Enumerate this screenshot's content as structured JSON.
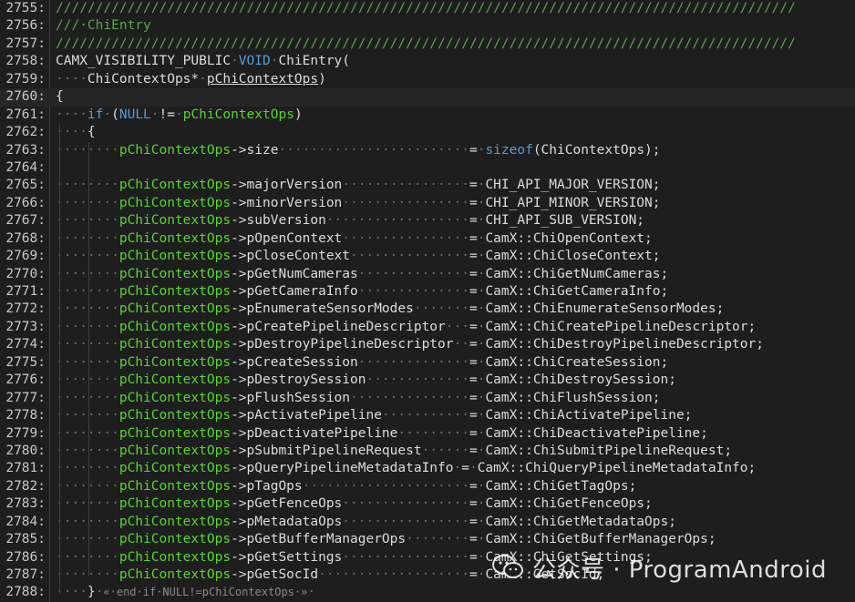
{
  "editor": {
    "lines": [
      {
        "num": "2755:",
        "tokens": [
          {
            "c": "t-comment",
            "t": "/////////////////////////////////////////////////////////////////////////////////////////////"
          }
        ]
      },
      {
        "num": "2756:",
        "tokens": [
          {
            "c": "t-comment",
            "t": "///·ChiEntry"
          }
        ]
      },
      {
        "num": "2757:",
        "tokens": [
          {
            "c": "t-comment",
            "t": "/////////////////////////////////////////////////////////////////////////////////////////////"
          }
        ]
      },
      {
        "num": "2758:",
        "tokens": [
          {
            "c": "t-plain",
            "t": "CAMX_VISIBILITY_PUBLIC"
          },
          {
            "c": "ws",
            "t": "·"
          },
          {
            "c": "t-kw",
            "t": "VOID"
          },
          {
            "c": "ws",
            "t": "·"
          },
          {
            "c": "t-plain",
            "t": "ChiEntry("
          }
        ]
      },
      {
        "num": "2759:",
        "tokens": [
          {
            "c": "ws",
            "t": "····"
          },
          {
            "c": "t-plain",
            "t": "ChiContextOps*"
          },
          {
            "c": "ws",
            "t": "·"
          },
          {
            "c": "t-param",
            "t": "pChiContextOps"
          },
          {
            "c": "t-plain",
            "t": ")"
          }
        ]
      },
      {
        "num": "2760:",
        "tokens": [
          {
            "c": "t-plain",
            "t": "{"
          }
        ]
      },
      {
        "num": "2761:",
        "tokens": [
          {
            "c": "ws",
            "t": "····"
          },
          {
            "c": "t-kw",
            "t": "if"
          },
          {
            "c": "ws",
            "t": "·"
          },
          {
            "c": "t-plain",
            "t": "("
          },
          {
            "c": "t-kw",
            "t": "NULL"
          },
          {
            "c": "ws",
            "t": "·"
          },
          {
            "c": "t-plain",
            "t": "!="
          },
          {
            "c": "ws",
            "t": "·"
          },
          {
            "c": "t-var",
            "t": "pChiContextOps"
          },
          {
            "c": "t-plain",
            "t": ")"
          }
        ]
      },
      {
        "num": "2762:",
        "tokens": [
          {
            "c": "ws",
            "t": "····"
          },
          {
            "c": "t-plain",
            "t": "{"
          }
        ]
      },
      {
        "num": "2763:",
        "tokens": [
          {
            "c": "ws",
            "t": "········"
          },
          {
            "c": "t-var",
            "t": "pChiContextOps"
          },
          {
            "c": "t-plain",
            "t": "->size"
          },
          {
            "c": "ws",
            "t": "························"
          },
          {
            "c": "t-plain",
            "t": "="
          },
          {
            "c": "ws",
            "t": "·"
          },
          {
            "c": "t-sizeof",
            "t": "sizeof"
          },
          {
            "c": "t-plain",
            "t": "(ChiContextOps);"
          }
        ]
      },
      {
        "num": "2764:",
        "tokens": []
      },
      {
        "num": "2765:",
        "tokens": [
          {
            "c": "ws",
            "t": "········"
          },
          {
            "c": "t-var",
            "t": "pChiContextOps"
          },
          {
            "c": "t-plain",
            "t": "->majorVersion"
          },
          {
            "c": "ws",
            "t": "················"
          },
          {
            "c": "t-plain",
            "t": "="
          },
          {
            "c": "ws",
            "t": "·"
          },
          {
            "c": "t-plain",
            "t": "CHI_API_MAJOR_VERSION;"
          }
        ]
      },
      {
        "num": "2766:",
        "tokens": [
          {
            "c": "ws",
            "t": "········"
          },
          {
            "c": "t-var",
            "t": "pChiContextOps"
          },
          {
            "c": "t-plain",
            "t": "->minorVersion"
          },
          {
            "c": "ws",
            "t": "················"
          },
          {
            "c": "t-plain",
            "t": "="
          },
          {
            "c": "ws",
            "t": "·"
          },
          {
            "c": "t-plain",
            "t": "CHI_API_MINOR_VERSION;"
          }
        ]
      },
      {
        "num": "2767:",
        "tokens": [
          {
            "c": "ws",
            "t": "········"
          },
          {
            "c": "t-var",
            "t": "pChiContextOps"
          },
          {
            "c": "t-plain",
            "t": "->subVersion"
          },
          {
            "c": "ws",
            "t": "··················"
          },
          {
            "c": "t-plain",
            "t": "="
          },
          {
            "c": "ws",
            "t": "·"
          },
          {
            "c": "t-plain",
            "t": "CHI_API_SUB_VERSION;"
          }
        ]
      },
      {
        "num": "2768:",
        "tokens": [
          {
            "c": "ws",
            "t": "········"
          },
          {
            "c": "t-var",
            "t": "pChiContextOps"
          },
          {
            "c": "t-plain",
            "t": "->pOpenContext"
          },
          {
            "c": "ws",
            "t": "················"
          },
          {
            "c": "t-plain",
            "t": "="
          },
          {
            "c": "ws",
            "t": "·"
          },
          {
            "c": "t-plain",
            "t": "CamX::ChiOpenContext;"
          }
        ]
      },
      {
        "num": "2769:",
        "tokens": [
          {
            "c": "ws",
            "t": "········"
          },
          {
            "c": "t-var",
            "t": "pChiContextOps"
          },
          {
            "c": "t-plain",
            "t": "->pCloseContext"
          },
          {
            "c": "ws",
            "t": "···············"
          },
          {
            "c": "t-plain",
            "t": "="
          },
          {
            "c": "ws",
            "t": "·"
          },
          {
            "c": "t-plain",
            "t": "CamX::ChiCloseContext;"
          }
        ]
      },
      {
        "num": "2770:",
        "tokens": [
          {
            "c": "ws",
            "t": "········"
          },
          {
            "c": "t-var",
            "t": "pChiContextOps"
          },
          {
            "c": "t-plain",
            "t": "->pGetNumCameras"
          },
          {
            "c": "ws",
            "t": "··············"
          },
          {
            "c": "t-plain",
            "t": "="
          },
          {
            "c": "ws",
            "t": "·"
          },
          {
            "c": "t-plain",
            "t": "CamX::ChiGetNumCameras;"
          }
        ]
      },
      {
        "num": "2771:",
        "tokens": [
          {
            "c": "ws",
            "t": "········"
          },
          {
            "c": "t-var",
            "t": "pChiContextOps"
          },
          {
            "c": "t-plain",
            "t": "->pGetCameraInfo"
          },
          {
            "c": "ws",
            "t": "··············"
          },
          {
            "c": "t-plain",
            "t": "="
          },
          {
            "c": "ws",
            "t": "·"
          },
          {
            "c": "t-plain",
            "t": "CamX::ChiGetCameraInfo;"
          }
        ]
      },
      {
        "num": "2772:",
        "tokens": [
          {
            "c": "ws",
            "t": "········"
          },
          {
            "c": "t-var",
            "t": "pChiContextOps"
          },
          {
            "c": "t-plain",
            "t": "->pEnumerateSensorModes"
          },
          {
            "c": "ws",
            "t": "·······"
          },
          {
            "c": "t-plain",
            "t": "="
          },
          {
            "c": "ws",
            "t": "·"
          },
          {
            "c": "t-plain",
            "t": "CamX::ChiEnumerateSensorModes;"
          }
        ]
      },
      {
        "num": "2773:",
        "tokens": [
          {
            "c": "ws",
            "t": "········"
          },
          {
            "c": "t-var",
            "t": "pChiContextOps"
          },
          {
            "c": "t-plain",
            "t": "->pCreatePipelineDescriptor"
          },
          {
            "c": "ws",
            "t": "···"
          },
          {
            "c": "t-plain",
            "t": "="
          },
          {
            "c": "ws",
            "t": "·"
          },
          {
            "c": "t-plain",
            "t": "CamX::ChiCreatePipelineDescriptor;"
          }
        ]
      },
      {
        "num": "2774:",
        "tokens": [
          {
            "c": "ws",
            "t": "········"
          },
          {
            "c": "t-var",
            "t": "pChiContextOps"
          },
          {
            "c": "t-plain",
            "t": "->pDestroyPipelineDescriptor"
          },
          {
            "c": "ws",
            "t": "··"
          },
          {
            "c": "t-plain",
            "t": "="
          },
          {
            "c": "ws",
            "t": "·"
          },
          {
            "c": "t-plain",
            "t": "CamX::ChiDestroyPipelineDescriptor;"
          }
        ]
      },
      {
        "num": "2775:",
        "tokens": [
          {
            "c": "ws",
            "t": "········"
          },
          {
            "c": "t-var",
            "t": "pChiContextOps"
          },
          {
            "c": "t-plain",
            "t": "->pCreateSession"
          },
          {
            "c": "ws",
            "t": "··············"
          },
          {
            "c": "t-plain",
            "t": "="
          },
          {
            "c": "ws",
            "t": "·"
          },
          {
            "c": "t-plain",
            "t": "CamX::ChiCreateSession;"
          }
        ]
      },
      {
        "num": "2776:",
        "tokens": [
          {
            "c": "ws",
            "t": "········"
          },
          {
            "c": "t-var",
            "t": "pChiContextOps"
          },
          {
            "c": "t-plain",
            "t": "->pDestroySession"
          },
          {
            "c": "ws",
            "t": "·············"
          },
          {
            "c": "t-plain",
            "t": "="
          },
          {
            "c": "ws",
            "t": "·"
          },
          {
            "c": "t-plain",
            "t": "CamX::ChiDestroySession;"
          }
        ]
      },
      {
        "num": "2777:",
        "tokens": [
          {
            "c": "ws",
            "t": "········"
          },
          {
            "c": "t-var",
            "t": "pChiContextOps"
          },
          {
            "c": "t-plain",
            "t": "->pFlushSession"
          },
          {
            "c": "ws",
            "t": "···············"
          },
          {
            "c": "t-plain",
            "t": "="
          },
          {
            "c": "ws",
            "t": "·"
          },
          {
            "c": "t-plain",
            "t": "CamX::ChiFlushSession;"
          }
        ]
      },
      {
        "num": "2778:",
        "tokens": [
          {
            "c": "ws",
            "t": "········"
          },
          {
            "c": "t-var",
            "t": "pChiContextOps"
          },
          {
            "c": "t-plain",
            "t": "->pActivatePipeline"
          },
          {
            "c": "ws",
            "t": "···········"
          },
          {
            "c": "t-plain",
            "t": "="
          },
          {
            "c": "ws",
            "t": "·"
          },
          {
            "c": "t-plain",
            "t": "CamX::ChiActivatePipeline;"
          }
        ]
      },
      {
        "num": "2779:",
        "tokens": [
          {
            "c": "ws",
            "t": "········"
          },
          {
            "c": "t-var",
            "t": "pChiContextOps"
          },
          {
            "c": "t-plain",
            "t": "->pDeactivatePipeline"
          },
          {
            "c": "ws",
            "t": "·········"
          },
          {
            "c": "t-plain",
            "t": "="
          },
          {
            "c": "ws",
            "t": "·"
          },
          {
            "c": "t-plain",
            "t": "CamX::ChiDeactivatePipeline;"
          }
        ]
      },
      {
        "num": "2780:",
        "tokens": [
          {
            "c": "ws",
            "t": "········"
          },
          {
            "c": "t-var",
            "t": "pChiContextOps"
          },
          {
            "c": "t-plain",
            "t": "->pSubmitPipelineRequest"
          },
          {
            "c": "ws",
            "t": "······"
          },
          {
            "c": "t-plain",
            "t": "="
          },
          {
            "c": "ws",
            "t": "·"
          },
          {
            "c": "t-plain",
            "t": "CamX::ChiSubmitPipelineRequest;"
          }
        ]
      },
      {
        "num": "2781:",
        "tokens": [
          {
            "c": "ws",
            "t": "········"
          },
          {
            "c": "t-var",
            "t": "pChiContextOps"
          },
          {
            "c": "t-plain",
            "t": "->pQueryPipelineMetadataInfo"
          },
          {
            "c": "ws",
            "t": "·"
          },
          {
            "c": "t-plain",
            "t": "="
          },
          {
            "c": "ws",
            "t": "·"
          },
          {
            "c": "t-plain",
            "t": "CamX::ChiQueryPipelineMetadataInfo;"
          }
        ]
      },
      {
        "num": "2782:",
        "tokens": [
          {
            "c": "ws",
            "t": "········"
          },
          {
            "c": "t-var",
            "t": "pChiContextOps"
          },
          {
            "c": "t-plain",
            "t": "->pTagOps"
          },
          {
            "c": "ws",
            "t": "·····················"
          },
          {
            "c": "t-plain",
            "t": "="
          },
          {
            "c": "ws",
            "t": "·"
          },
          {
            "c": "t-plain",
            "t": "CamX::ChiGetTagOps;"
          }
        ]
      },
      {
        "num": "2783:",
        "tokens": [
          {
            "c": "ws",
            "t": "········"
          },
          {
            "c": "t-var",
            "t": "pChiContextOps"
          },
          {
            "c": "t-plain",
            "t": "->pGetFenceOps"
          },
          {
            "c": "ws",
            "t": "················"
          },
          {
            "c": "t-plain",
            "t": "="
          },
          {
            "c": "ws",
            "t": "·"
          },
          {
            "c": "t-plain",
            "t": "CamX::ChiGetFenceOps;"
          }
        ]
      },
      {
        "num": "2784:",
        "tokens": [
          {
            "c": "ws",
            "t": "········"
          },
          {
            "c": "t-var",
            "t": "pChiContextOps"
          },
          {
            "c": "t-plain",
            "t": "->pMetadataOps"
          },
          {
            "c": "ws",
            "t": "················"
          },
          {
            "c": "t-plain",
            "t": "="
          },
          {
            "c": "ws",
            "t": "·"
          },
          {
            "c": "t-plain",
            "t": "CamX::ChiGetMetadataOps;"
          }
        ]
      },
      {
        "num": "2785:",
        "tokens": [
          {
            "c": "ws",
            "t": "········"
          },
          {
            "c": "t-var",
            "t": "pChiContextOps"
          },
          {
            "c": "t-plain",
            "t": "->pGetBufferManagerOps"
          },
          {
            "c": "ws",
            "t": "········"
          },
          {
            "c": "t-plain",
            "t": "="
          },
          {
            "c": "ws",
            "t": "·"
          },
          {
            "c": "t-plain",
            "t": "CamX::ChiGetBufferManagerOps;"
          }
        ]
      },
      {
        "num": "2786:",
        "tokens": [
          {
            "c": "ws",
            "t": "········"
          },
          {
            "c": "t-var",
            "t": "pChiContextOps"
          },
          {
            "c": "t-plain",
            "t": "->pGetSettings"
          },
          {
            "c": "ws",
            "t": "················"
          },
          {
            "c": "t-plain",
            "t": "="
          },
          {
            "c": "ws",
            "t": "·"
          },
          {
            "c": "t-plain",
            "t": "CamX::ChiGetSettings;"
          }
        ]
      },
      {
        "num": "2787:",
        "tokens": [
          {
            "c": "ws",
            "t": "········"
          },
          {
            "c": "t-var",
            "t": "pChiContextOps"
          },
          {
            "c": "t-plain",
            "t": "->pGetSocId"
          },
          {
            "c": "ws",
            "t": "···················"
          },
          {
            "c": "t-plain",
            "t": "="
          },
          {
            "c": "ws",
            "t": "·"
          },
          {
            "c": "t-plain",
            "t": "CamX::GetSocId;"
          }
        ]
      },
      {
        "num": "2788:",
        "tokens": [
          {
            "c": "ws",
            "t": "····"
          },
          {
            "c": "t-plain",
            "t": "}"
          },
          {
            "c": "ws",
            "t": "·"
          },
          {
            "c": "t-fold",
            "t": "«·end·if·NULL!=pChiContextOps·»"
          },
          {
            "c": "ws",
            "t": "·"
          }
        ]
      }
    ]
  },
  "watermark": {
    "text": "公众号 · ProgramAndroid",
    "icon": "wechat-icon"
  },
  "colors": {
    "background": "#1e1e1e",
    "keyword": "#569cd6",
    "variable": "#57d62f",
    "comment": "#57a64a"
  }
}
